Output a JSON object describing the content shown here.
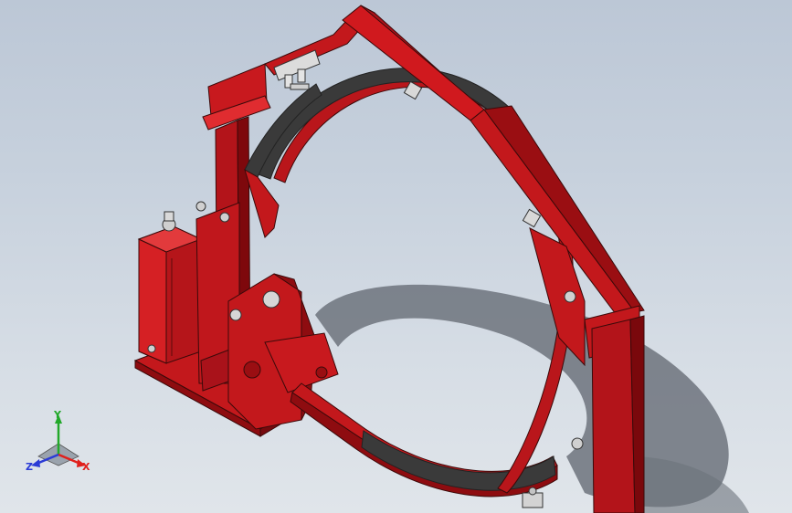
{
  "viewport": {
    "background_top": "#bcc7d6",
    "background_bottom": "#e0e5ea",
    "model": {
      "name": "",
      "primary_color": "#c3181c",
      "shade_color": "#8e0c10",
      "lining_color": "#3a3a3a"
    }
  },
  "triad": {
    "x_label": "X",
    "y_label": "Y",
    "z_label": "Z",
    "x_color": "#e0201c",
    "y_color": "#22a82a",
    "z_color": "#2b3bd6"
  }
}
